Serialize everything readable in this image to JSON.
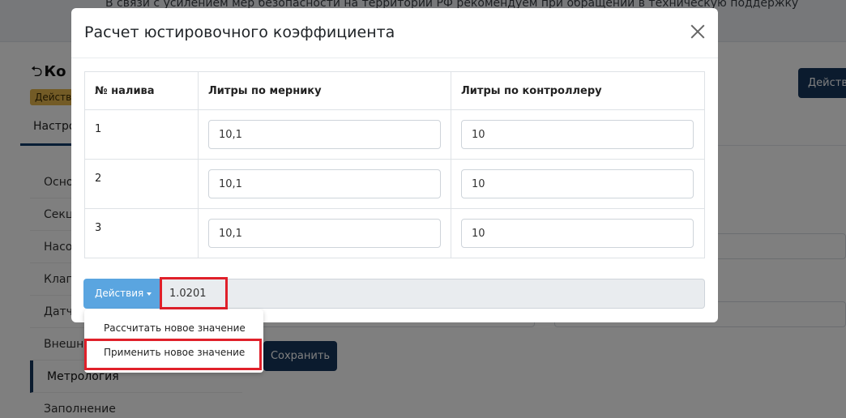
{
  "background": {
    "notice_text": "В связи с усилением мер безопасности на территории РФ рекомендуем при обращении в техническую поддержку",
    "back_title": "Ко",
    "status_badge": "Действ",
    "tab_settings": "Настро",
    "actions_button": "Действи",
    "sidebar_items": [
      "Осно",
      "Секц",
      "Насо",
      "Клап",
      "Датч",
      "Внешни",
      "Метрология",
      "Заполнение"
    ],
    "save_button": "Сохранить"
  },
  "modal": {
    "title": "Расчет юстировочного коэффициента",
    "table": {
      "headers": [
        "№ налива",
        "Литры по мернику",
        "Литры по контроллеру"
      ],
      "rows": [
        {
          "num": "1",
          "meter": "10,1",
          "controller": "10"
        },
        {
          "num": "2",
          "meter": "10,1",
          "controller": "10"
        },
        {
          "num": "3",
          "meter": "10,1",
          "controller": "10"
        }
      ]
    },
    "actions_dropdown_label": "Действия",
    "coefficient_value": "1.0201",
    "dropdown_items": [
      "Рассчитать новое значение",
      "Применить новое значение"
    ]
  },
  "colors": {
    "highlight": "#e0202a",
    "primary_dark": "#17365d",
    "dropdown_button": "#5aa5e0"
  }
}
